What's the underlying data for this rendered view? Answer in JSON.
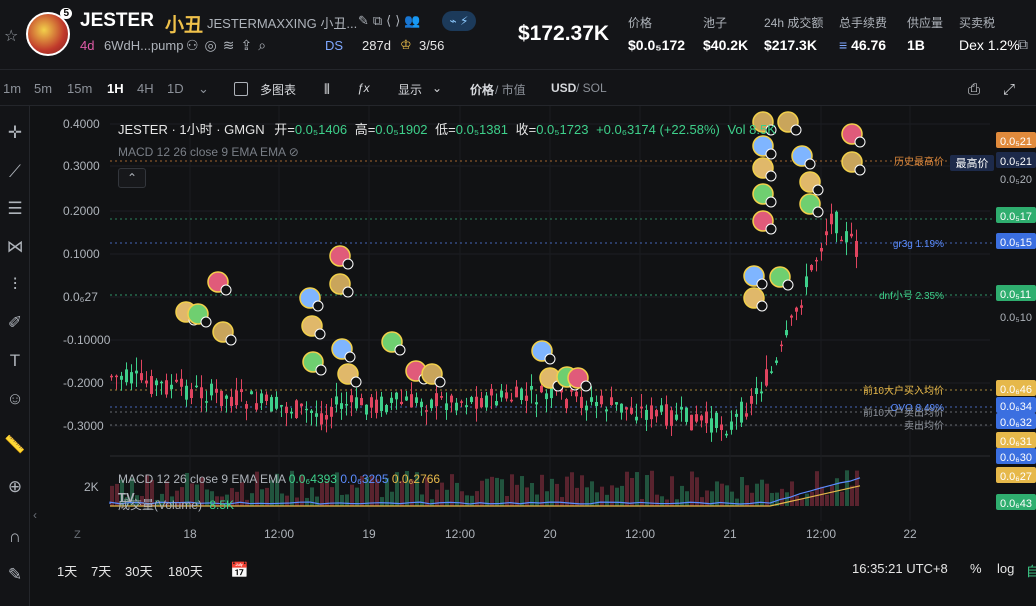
{
  "header": {
    "token_name": "JESTER",
    "token_cn": "小丑",
    "token_full": "JESTERMAXXING 小丑...",
    "avatar_badge": "5",
    "age": "4d",
    "address": "6WdH...pump",
    "ds_label": "DS",
    "ds_value": "287d",
    "crown_value": "3/56",
    "market_cap": "$172.37K",
    "stats": [
      {
        "label": "价格",
        "value": "$0.0₅172"
      },
      {
        "label": "池子",
        "value": "$40.2K"
      },
      {
        "label": "24h 成交额",
        "value": "$217.3K"
      },
      {
        "label": "总手续费",
        "value": "46.76"
      },
      {
        "label": "供应量",
        "value": "1B"
      },
      {
        "label": "买卖税",
        "value": "Dex 1.2%"
      }
    ]
  },
  "toolbar": {
    "timeframes": [
      "1m",
      "5m",
      "15m",
      "1H",
      "4H",
      "1D"
    ],
    "active_timeframe": "1H",
    "multi_chart": "多图表",
    "display": "显示",
    "price": "价格",
    "mcap": "市值",
    "usd": "USD",
    "sol": "SOL"
  },
  "legend": {
    "title": "JESTER · 1小时 · GMGN",
    "open_label": "开=",
    "open": "0.0₅1406",
    "high_label": "高=",
    "high": "0.0₅1902",
    "low_label": "低=",
    "low": "0.0₅1381",
    "close_label": "收=",
    "close": "0.0₅1723",
    "change": "+0.0₆3174 (+22.58%)",
    "vol": "Vol 8.5K",
    "macd": "MACD 12 26 close 9 EMA EMA"
  },
  "macd_panel": {
    "label": "MACD 12 26 close 9 EMA EMA",
    "v1": "0.0₆4393",
    "v2": "0.0₆3205",
    "v3": "0.0₆2766",
    "volume_label": "成交量(Volume)",
    "volume_value": "8.5K",
    "axis_2k": "2K"
  },
  "chart_data": {
    "type": "candlestick",
    "title": "JESTER · 1小时 · GMGN",
    "y_ticks": [
      "0.4000",
      "0.3000",
      "0.2000",
      "0.1000",
      "0.0₆27",
      "-0.10000",
      "-0.2000",
      "-0.3000"
    ],
    "x_ticks": [
      "18",
      "12:00",
      "19",
      "12:00",
      "20",
      "12:00",
      "21",
      "12:00",
      "22"
    ],
    "price_lines": [
      {
        "label": "历史最高价",
        "color": "#e08a3c"
      },
      {
        "label": "gr3g 1.19%",
        "color": "#5b8cff"
      },
      {
        "label": "dnf小号 2.35%",
        "color": "#3ed08b"
      },
      {
        "label": "前10大户买入均价",
        "color": "#e6b84a"
      },
      {
        "label": "OVO 8.49%",
        "color": "#5b8cff"
      },
      {
        "label": "前10大户卖出均价",
        "color": "#8c9199"
      },
      {
        "label": "卖出均价",
        "color": "#8c9199"
      }
    ],
    "right_labels": [
      {
        "text": "0.0₅21",
        "bg": "#e08a3c"
      },
      {
        "text": "0.0₅21",
        "bg": "#1d2a4a"
      },
      {
        "text": "0.0₅20",
        "bg": "none"
      },
      {
        "text": "0.0₅17",
        "bg": "#2fae6f"
      },
      {
        "text": "0.0₅15",
        "bg": "#3b6fe0"
      },
      {
        "text": "0.0₅11",
        "bg": "#2fae6f"
      },
      {
        "text": "0.0₅10",
        "bg": "none"
      },
      {
        "text": "0.0₆46",
        "bg": "#e6b84a"
      },
      {
        "text": "0.0₆34",
        "bg": "#3b6fe0"
      },
      {
        "text": "0.0₆32",
        "bg": "#3b6fe0"
      },
      {
        "text": "0.0₆31",
        "bg": "#e6b84a"
      },
      {
        "text": "0.0₆30",
        "bg": "#3b6fe0"
      },
      {
        "text": "0.0₆27",
        "bg": "#e6b84a"
      },
      {
        "text": "0.0₆43",
        "bg": "#2fae6f"
      }
    ],
    "ath_label": "最高价"
  },
  "bottom": {
    "ranges": [
      "1天",
      "7天",
      "30天",
      "180天"
    ],
    "time": "16:35:21 UTC+8",
    "percent": "%",
    "log": "log",
    "auto": "自"
  },
  "colors": {
    "up": "#3ed08b",
    "down": "#e0445f",
    "bg": "#111214"
  }
}
